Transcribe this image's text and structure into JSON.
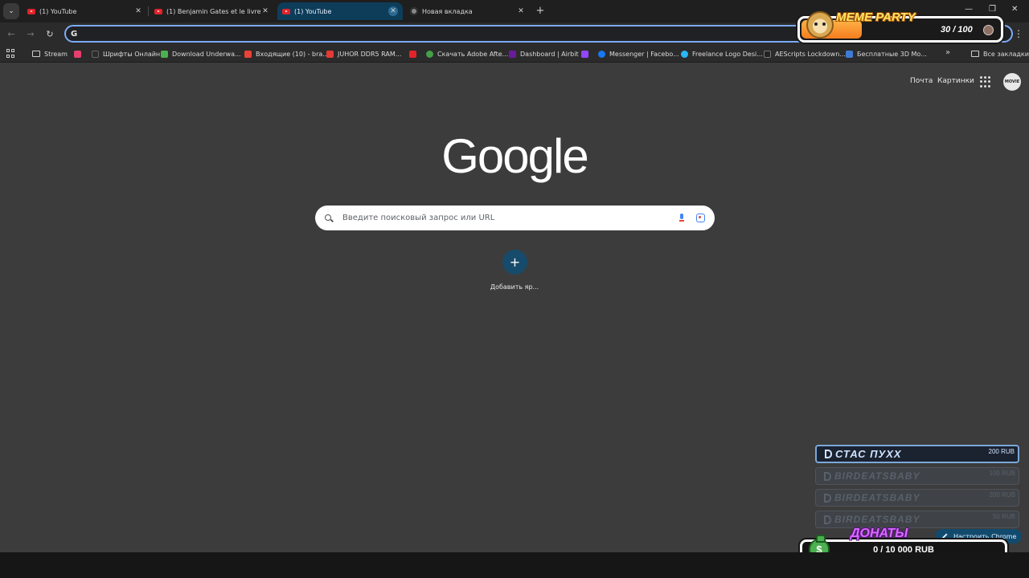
{
  "tabs": [
    {
      "title": "(1) YouTube",
      "icon": "youtube-icon"
    },
    {
      "title": "(1) Benjamin Gates et le livre des",
      "icon": "youtube-icon"
    },
    {
      "title": "(1) YouTube",
      "icon": "youtube-icon",
      "active": true
    },
    {
      "title": "Новая вкладка",
      "icon": "chrome-icon"
    }
  ],
  "toolbar": {
    "omnibox_value": ""
  },
  "bookmarks": {
    "items": [
      {
        "label": "Stream",
        "icon": "folder-icon"
      },
      {
        "label": "",
        "icon": "tool-icon",
        "color": "#e63f6d"
      },
      {
        "label": "Шрифты Онлайн",
        "icon": "font-icon",
        "color": "#2b2b2b"
      },
      {
        "label": "Download Underwa...",
        "icon": "download-icon",
        "color": "#4caf50"
      },
      {
        "label": "Входящие (10) - bra...",
        "icon": "gmail-icon",
        "color": "#ea4335"
      },
      {
        "label": "JUHOR DDR5 RAM...",
        "icon": "aliexpress-icon",
        "color": "#e53935"
      },
      {
        "label": "",
        "icon": "youtube-icon",
        "color": "#e2242a"
      },
      {
        "label": "Скачать Adobe Afte...",
        "icon": "torrent-icon",
        "color": "#43a047"
      },
      {
        "label": "Dashboard | Airbit",
        "icon": "airbit-icon",
        "color": "#6a1b9a"
      },
      {
        "label": "",
        "icon": "twitch-icon",
        "color": "#9146ff"
      },
      {
        "label": "Messenger | Facebo...",
        "icon": "facebook-icon",
        "color": "#1877f2"
      },
      {
        "label": "Freelance Logo Desi...",
        "icon": "freelance-icon",
        "color": "#29b6f6"
      },
      {
        "label": "AEScripts Lockdown...",
        "icon": "tiktok-icon",
        "color": "#222222"
      },
      {
        "label": "Бесплатные 3D Мо...",
        "icon": "3d-icon",
        "color": "#3f7bd6"
      }
    ],
    "all_bookmarks_label": "Все закладки"
  },
  "ntp": {
    "mail_link": "Почта",
    "images_link": "Картинки",
    "logo_text": "Google",
    "search_placeholder": "Введите поисковый запрос или URL",
    "add_shortcut_label": "Добавить яр...",
    "customize_label": "Настроить Chrome"
  },
  "overlay": {
    "meme_title": "MEME PARTY",
    "meme_count": "30 / 100",
    "meme_progress": 0.3,
    "donations": [
      {
        "name": "СТАС ПУХХ",
        "amount": "200 RUB"
      },
      {
        "name": "BIRDEATSBABY",
        "amount": "100 RUB"
      },
      {
        "name": "BIRDEATSBABY",
        "amount": "200 RUB"
      },
      {
        "name": "BIRDEATSBABY",
        "amount": "50 RUB"
      }
    ],
    "donate_title": "ДОНАТЫ",
    "donate_amount": "0 / 10 000 RUB",
    "donate_progress": 0
  },
  "colors": {
    "accent": "#7cacf8",
    "active_tab": "#0e3d5a",
    "shortcut_bg": "#174b6b"
  }
}
